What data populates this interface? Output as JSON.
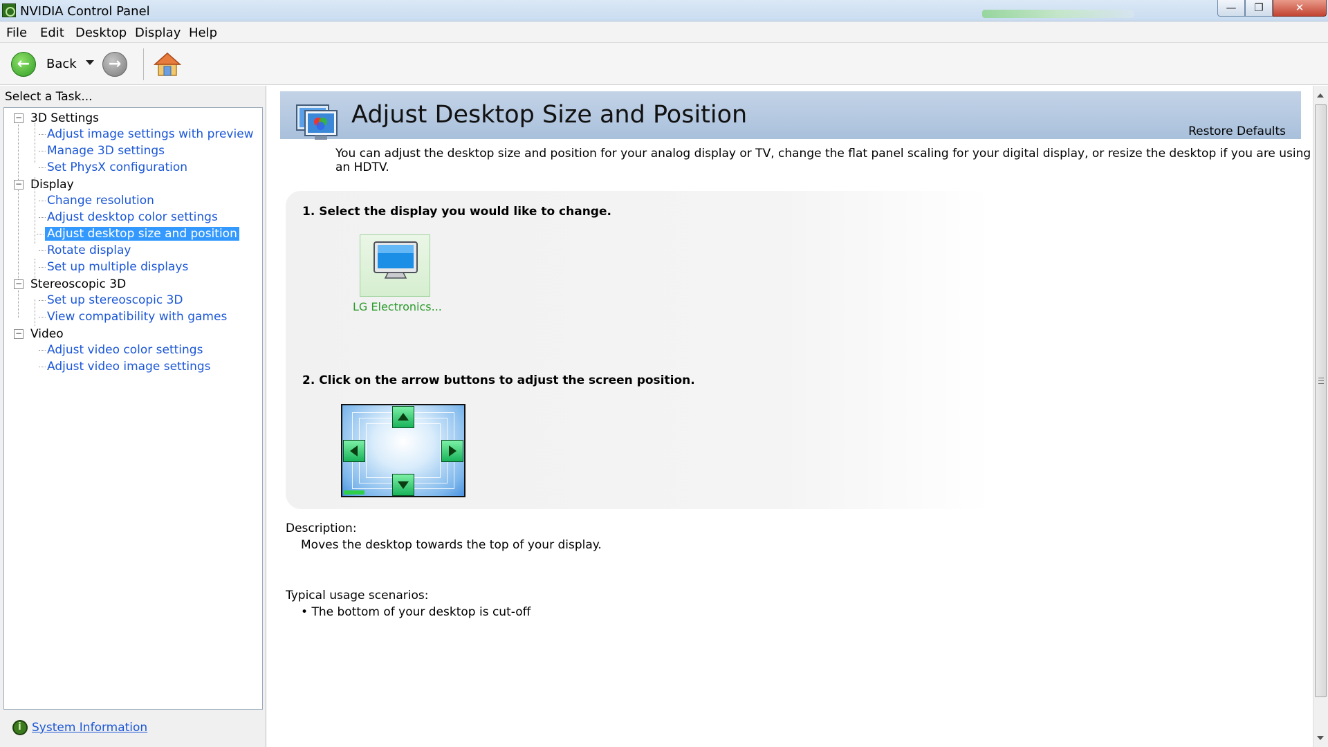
{
  "window": {
    "title": "NVIDIA Control Panel",
    "controls": {
      "minimize": "—",
      "maximize": "❐",
      "close": "✕"
    }
  },
  "menubar": [
    "File",
    "Edit",
    "Desktop",
    "Display",
    "Help"
  ],
  "toolbar": {
    "back_label": "Back",
    "back_icon": "←",
    "forward_icon": "→"
  },
  "sidebar": {
    "task_label": "Select a Task...",
    "categories": [
      {
        "name": "3D Settings",
        "items": [
          "Adjust image settings with preview",
          "Manage 3D settings",
          "Set PhysX configuration"
        ]
      },
      {
        "name": "Display",
        "items": [
          "Change resolution",
          "Adjust desktop color settings",
          "Adjust desktop size and position",
          "Rotate display",
          "Set up multiple displays"
        ]
      },
      {
        "name": "Stereoscopic 3D",
        "items": [
          "Set up stereoscopic 3D",
          "View compatibility with games"
        ]
      },
      {
        "name": "Video",
        "items": [
          "Adjust video color settings",
          "Adjust video image settings"
        ]
      }
    ],
    "selected_item": "Adjust desktop size and position",
    "system_info": "System Information"
  },
  "main": {
    "title": "Adjust Desktop Size and Position",
    "restore_defaults": "Restore Defaults",
    "intro": "You can adjust the desktop size and position for your analog display or TV, change the flat panel scaling for your digital display, or resize the desktop if you are using an HDTV.",
    "step1": "1. Select the display you would like to change.",
    "display_name": "LG Electronics...",
    "step2": "2. Click on the arrow buttons to adjust the screen position.",
    "description_label": "Description:",
    "description": "Moves the desktop towards the top of your display.",
    "usage_label": "Typical usage scenarios:",
    "usage_items": [
      "The bottom of your desktop is cut-off"
    ]
  },
  "colors": {
    "link": "#1a56d6",
    "selected": "#3399ff",
    "header_band": "#b3c7df",
    "display_green": "#2c9b2c"
  }
}
